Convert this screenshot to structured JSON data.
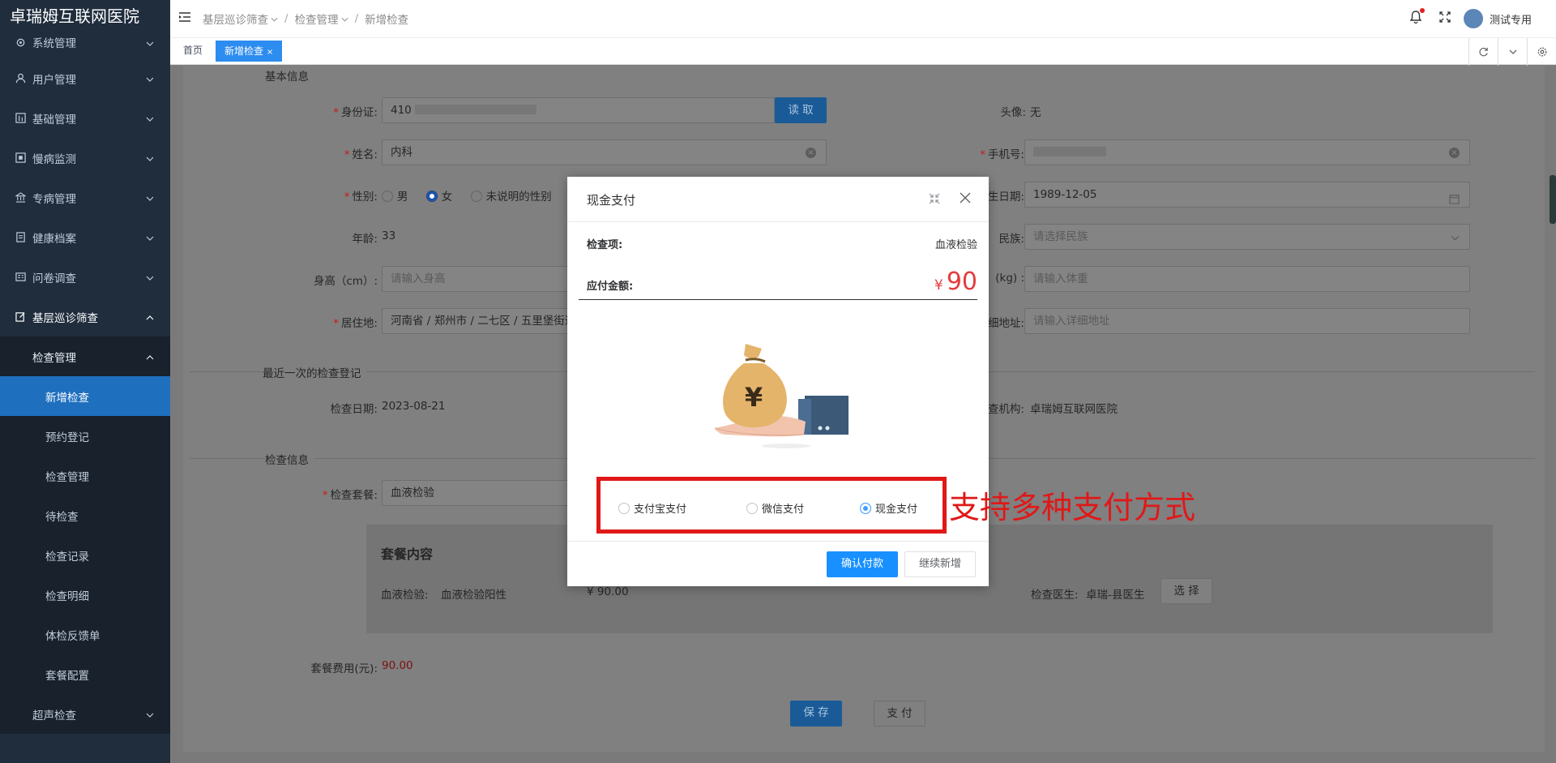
{
  "sidebar": {
    "title": "卓瑞姆互联网医院",
    "items": [
      {
        "label": "系统管理"
      },
      {
        "label": "用户管理"
      },
      {
        "label": "基础管理"
      },
      {
        "label": "慢病监测"
      },
      {
        "label": "专病管理"
      },
      {
        "label": "健康档案"
      },
      {
        "label": "问卷调查"
      },
      {
        "label": "基层巡诊筛查"
      }
    ],
    "sub_title": "检查管理",
    "leaves": [
      "新增检查",
      "预约登记",
      "检查管理",
      "待检查",
      "检查记录",
      "检查明细",
      "体检反馈单",
      "套餐配置"
    ],
    "last": "超声检查"
  },
  "topbar": {
    "breadcrumb": [
      "基层巡诊筛查",
      "检查管理",
      "新增检查"
    ],
    "user": "测试专用"
  },
  "tabs": [
    "首页",
    "新增检查"
  ],
  "form": {
    "section_basic": "基本信息",
    "id_label": "身份证:",
    "id_value": "410",
    "read_button": "读 取",
    "avatar_label": "头像:",
    "avatar_value": "无",
    "name_label": "姓名:",
    "name_value": "内科",
    "phone_label": "手机号:",
    "gender_label": "性别:",
    "gender_options": [
      "男",
      "女",
      "未说明的性别"
    ],
    "birth_label": "生日期:",
    "birth_value": "1989-12-05",
    "age_label": "年龄:",
    "age_value": "33",
    "nation_label": "民族:",
    "nation_placeholder": "请选择民族",
    "height_label": "身高（cm）:",
    "height_placeholder": "请输入身高",
    "weight_label": "(kg) :",
    "weight_placeholder": "请输入体重",
    "address_label": "居住地:",
    "address_value": "河南省 / 郑州市 / 二七区 / 五里堡街道 /",
    "detail_label": "细地址:",
    "detail_placeholder": "请输入详细地址",
    "section_recent": "最近一次的检查登记",
    "exam_date_label": "检查日期:",
    "exam_date_value": "2023-08-21",
    "org_label": "查机构:",
    "org_value": "卓瑞姆互联网医院",
    "section_exam": "检查信息",
    "pkg_label": "检查套餐:",
    "pkg_value": "血液检验",
    "pkg_title": "套餐内容",
    "pkg_item_label": "血液检验:",
    "pkg_item_value": "血液检验阳性",
    "pkg_item_price": "¥ 90.00",
    "doctor_label": "检查医生:",
    "doctor_value": "卓瑞-县医生",
    "doctor_button": "选 择",
    "fee_label": "套餐费用(元):",
    "fee_value": "90.00",
    "save_button": "保 存",
    "pay_button": "支 付"
  },
  "dialog": {
    "title": "现金支付",
    "item_label": "检查项:",
    "item_value": "血液检验",
    "amount_label": "应付金额:",
    "amount_symbol": "¥",
    "amount_value": "90",
    "pay_options": [
      "支付宝支付",
      "微信支付",
      "现金支付"
    ],
    "selected": "现金支付",
    "confirm_button": "确认付款",
    "continue_button": "继续新增"
  },
  "annotation": "支持多种支付方式",
  "colors": {
    "sidebar": "#1f2d3d",
    "active": "#1f6fbf",
    "primary": "#1890ff",
    "annotation": "#e01818",
    "amount": "#e43b3b"
  }
}
